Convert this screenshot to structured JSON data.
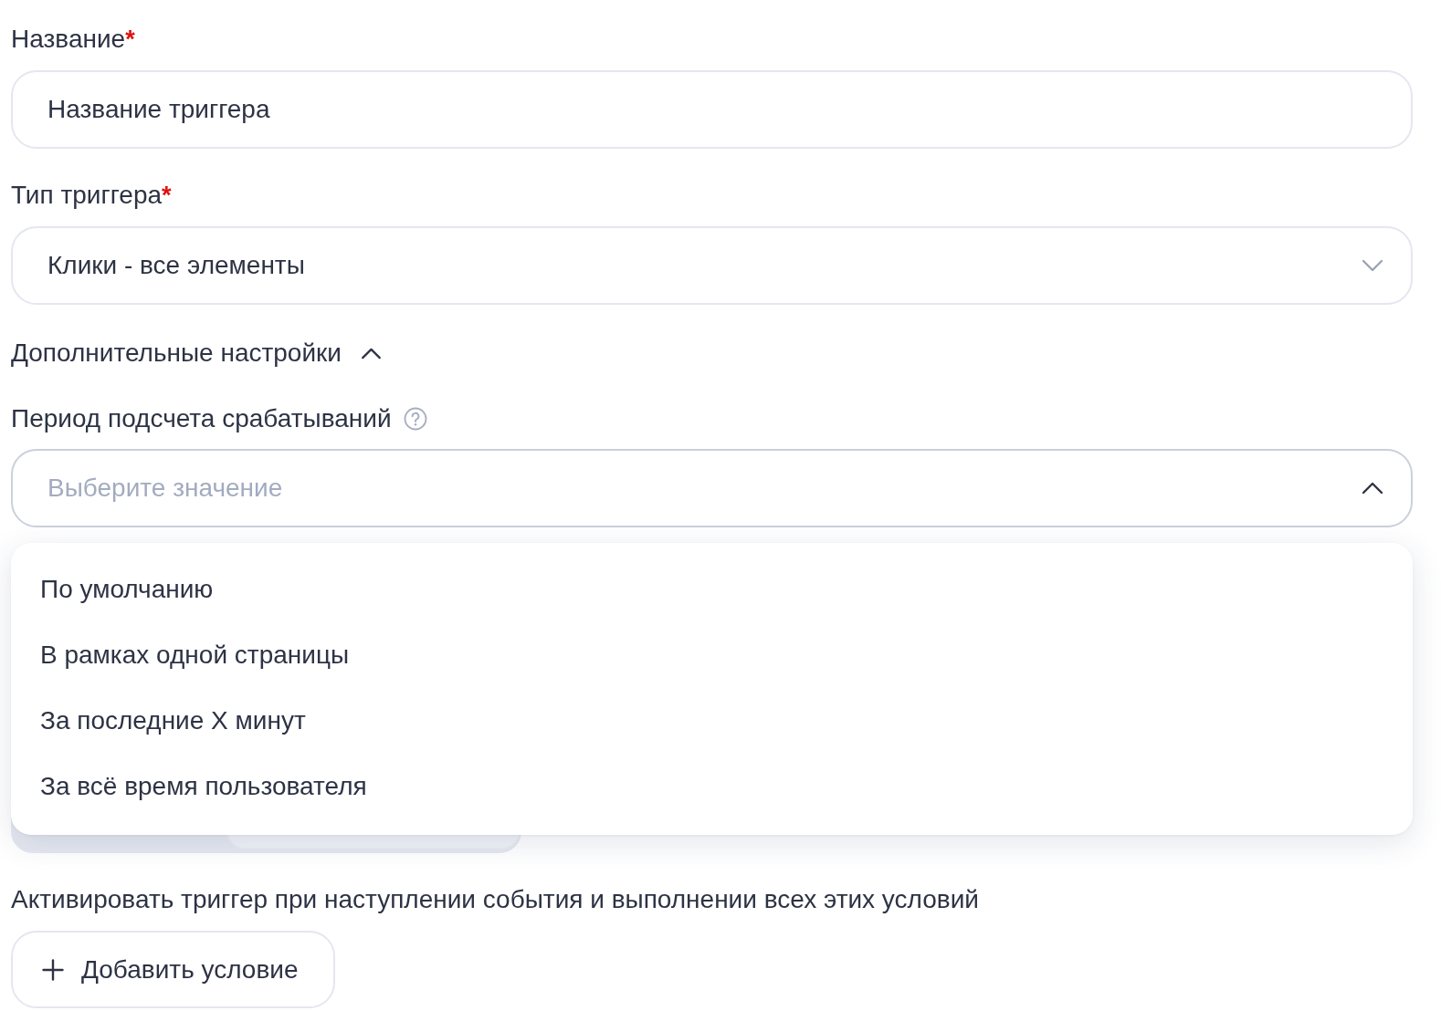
{
  "fields": [
    {
      "kind": "input",
      "label": "Название",
      "required_mark": "*",
      "value": "Название триггера"
    },
    {
      "kind": "select",
      "label": "Тип триггера",
      "required_mark": "*",
      "value": "Клики - все элементы",
      "expanded": false
    }
  ],
  "advanced_settings": {
    "label": "Дополнительные настройки",
    "expanded": true
  },
  "period": {
    "label": "Период подсчета срабатываний",
    "placeholder": "Выберите значение",
    "expanded": true,
    "options": [
      {
        "label": "По умолчанию",
        "selected": false
      },
      {
        "label": "В рамках одной страницы",
        "selected": false
      },
      {
        "label": "За последние X минут",
        "selected": false
      },
      {
        "label": "За всё время пользователя",
        "selected": false
      }
    ]
  },
  "conditions": {
    "label": "Активировать триггер при наступлении события и выполнении всех этих условий",
    "add_button": "Добавить условие"
  }
}
